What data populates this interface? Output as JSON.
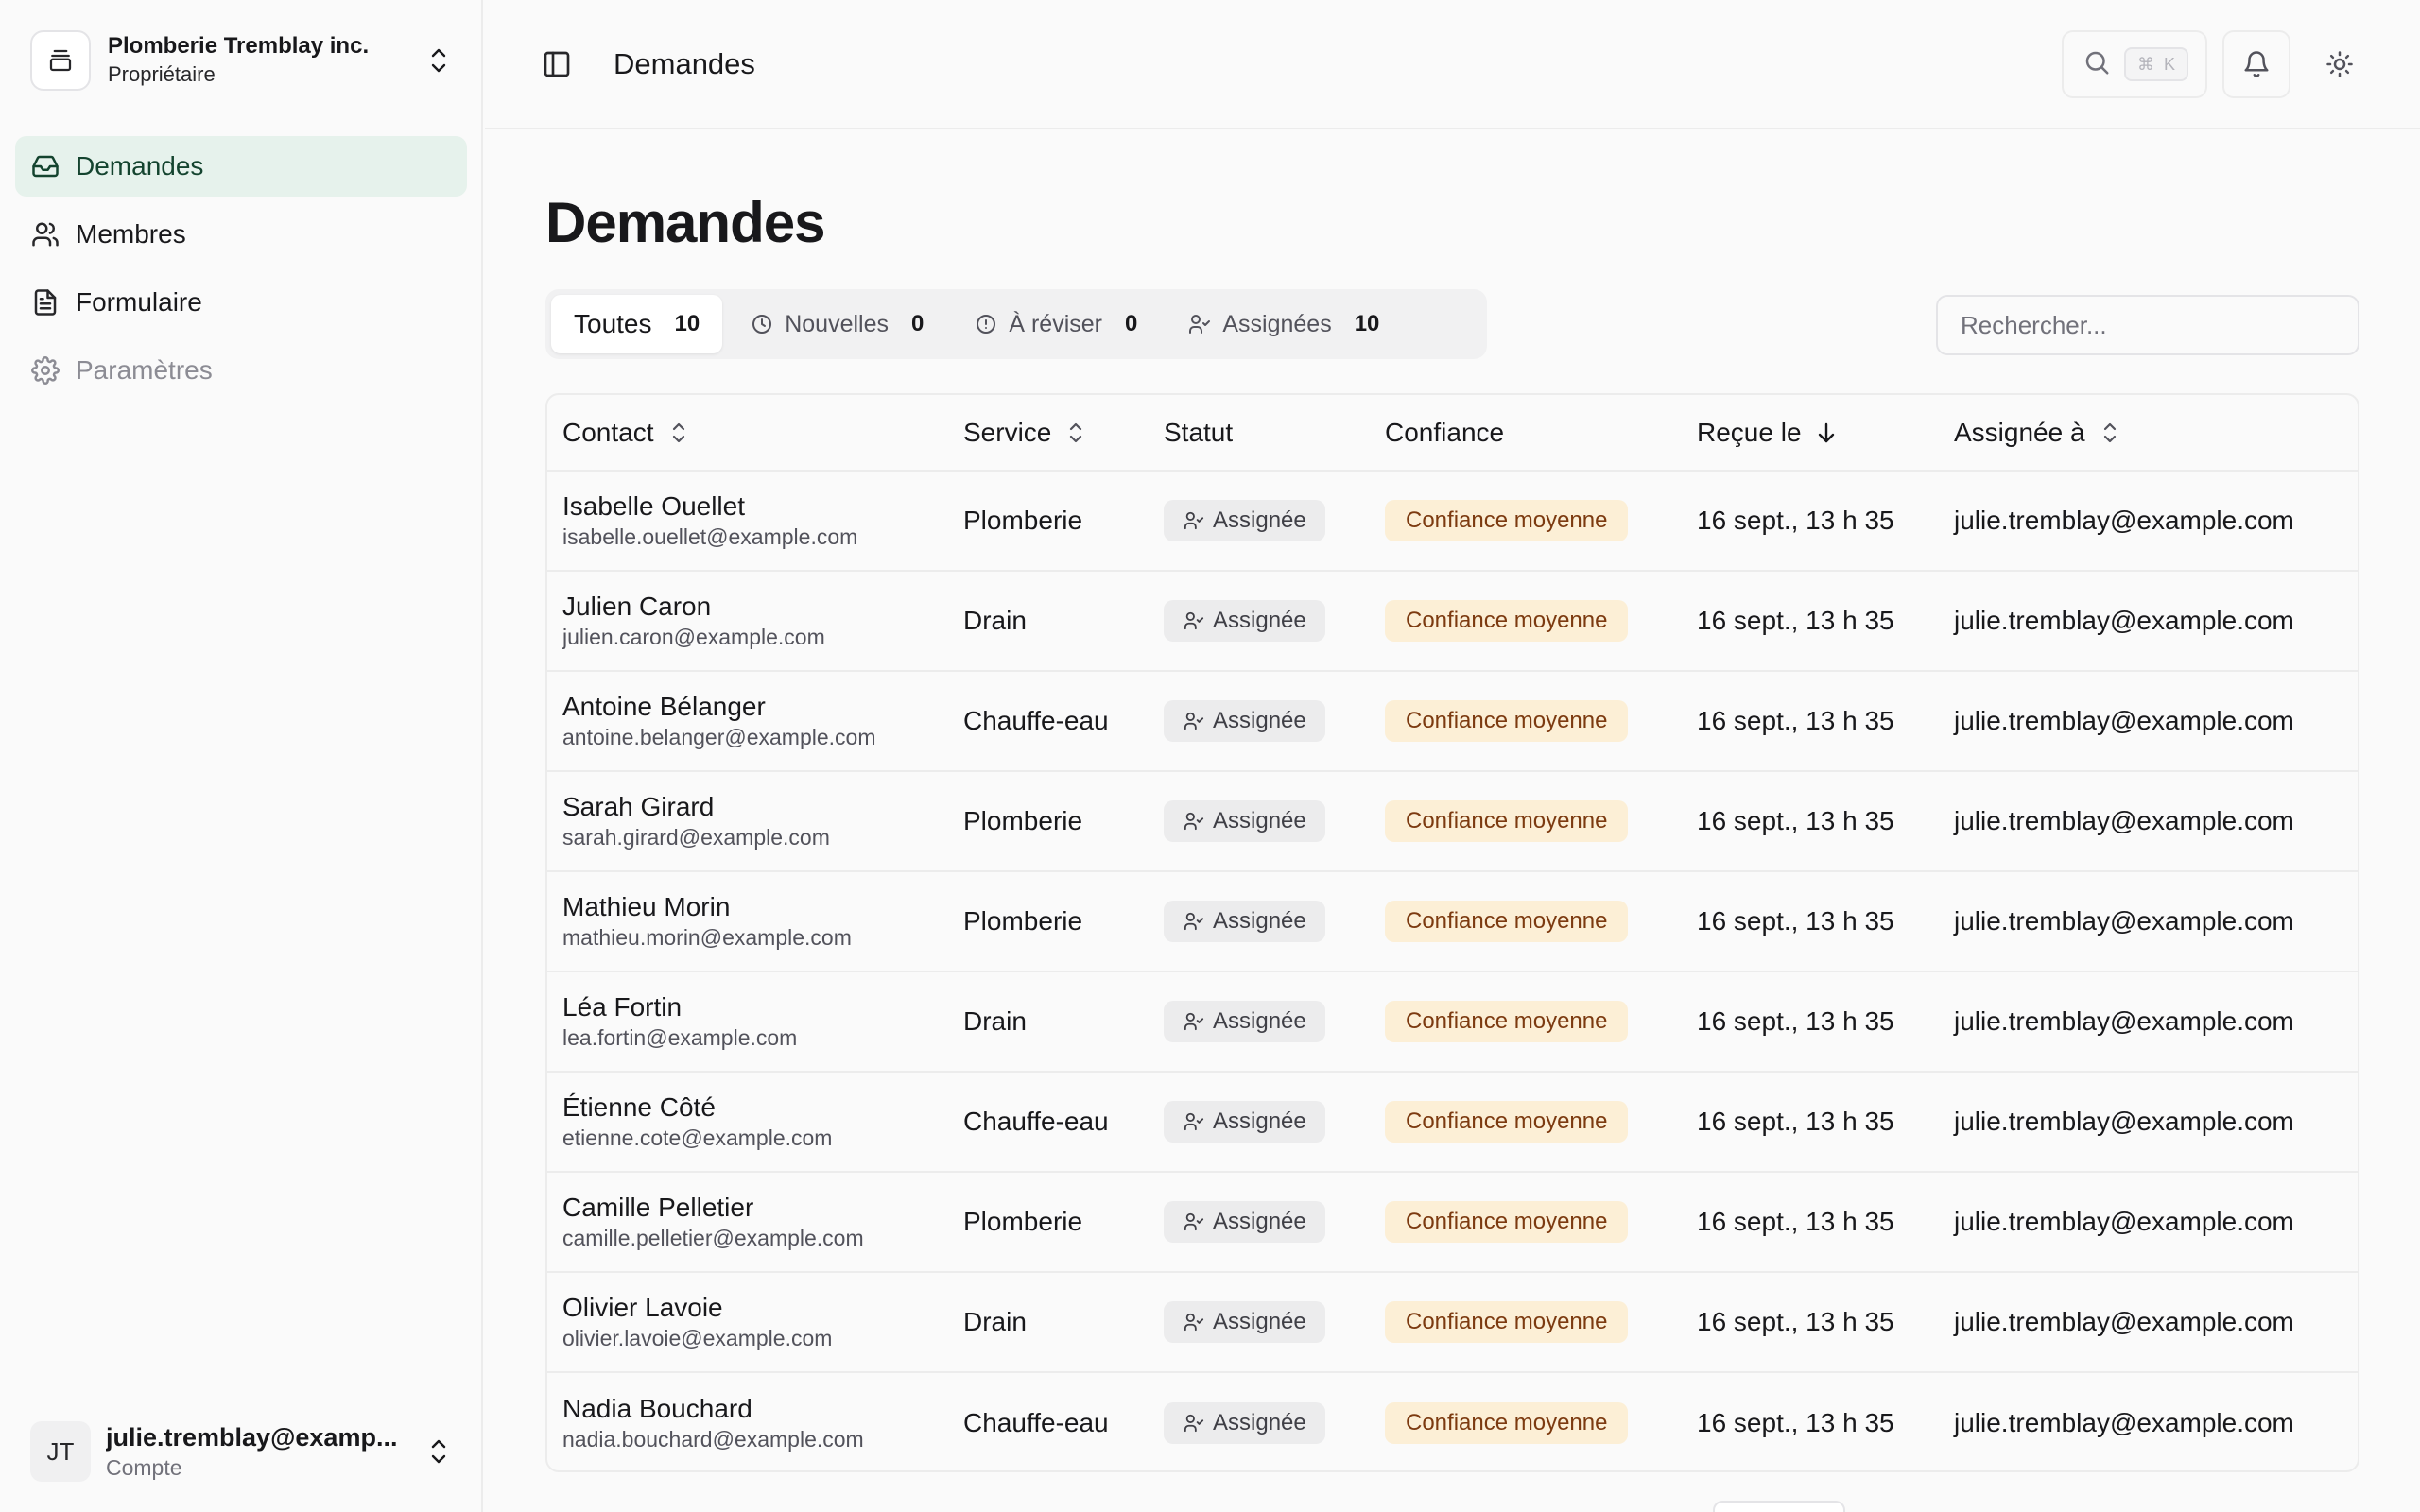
{
  "org": {
    "name": "Plomberie Tremblay inc.",
    "role": "Propriétaire"
  },
  "nav": {
    "items": [
      {
        "label": "Demandes",
        "icon": "inbox-icon",
        "active": true
      },
      {
        "label": "Membres",
        "icon": "users-icon"
      },
      {
        "label": "Formulaire",
        "icon": "file-text-icon"
      },
      {
        "label": "Paramètres",
        "icon": "gear-icon",
        "disabled": true
      }
    ]
  },
  "account": {
    "initials": "JT",
    "email": "julie.tremblay@examp...",
    "label": "Compte"
  },
  "topbar": {
    "breadcrumb": "Demandes",
    "shortcut_symbol": "⌘",
    "shortcut_key": "K"
  },
  "page": {
    "title": "Demandes"
  },
  "tabs": [
    {
      "label": "Toutes",
      "count": "10",
      "active": true
    },
    {
      "label": "Nouvelles",
      "count": "0",
      "icon": "clock-icon"
    },
    {
      "label": "À réviser",
      "count": "0",
      "icon": "alert-circle-icon"
    },
    {
      "label": "Assignées",
      "count": "10",
      "icon": "user-check-icon"
    }
  ],
  "search": {
    "placeholder": "Rechercher..."
  },
  "table": {
    "headers": {
      "contact": "Contact",
      "service": "Service",
      "status": "Statut",
      "confidence": "Confiance",
      "received": "Reçue le",
      "assigned": "Assignée à"
    },
    "rows": [
      {
        "name": "Isabelle Ouellet",
        "email": "isabelle.ouellet@example.com",
        "service": "Plomberie",
        "status": "Assignée",
        "confidence": "Confiance moyenne",
        "received": "16 sept., 13 h 35",
        "assigned": "julie.tremblay@example.com"
      },
      {
        "name": "Julien Caron",
        "email": "julien.caron@example.com",
        "service": "Drain",
        "status": "Assignée",
        "confidence": "Confiance moyenne",
        "received": "16 sept., 13 h 35",
        "assigned": "julie.tremblay@example.com"
      },
      {
        "name": "Antoine Bélanger",
        "email": "antoine.belanger@example.com",
        "service": "Chauffe-eau",
        "status": "Assignée",
        "confidence": "Confiance moyenne",
        "received": "16 sept., 13 h 35",
        "assigned": "julie.tremblay@example.com"
      },
      {
        "name": "Sarah Girard",
        "email": "sarah.girard@example.com",
        "service": "Plomberie",
        "status": "Assignée",
        "confidence": "Confiance moyenne",
        "received": "16 sept., 13 h 35",
        "assigned": "julie.tremblay@example.com"
      },
      {
        "name": "Mathieu Morin",
        "email": "mathieu.morin@example.com",
        "service": "Plomberie",
        "status": "Assignée",
        "confidence": "Confiance moyenne",
        "received": "16 sept., 13 h 35",
        "assigned": "julie.tremblay@example.com"
      },
      {
        "name": "Léa Fortin",
        "email": "lea.fortin@example.com",
        "service": "Drain",
        "status": "Assignée",
        "confidence": "Confiance moyenne",
        "received": "16 sept., 13 h 35",
        "assigned": "julie.tremblay@example.com"
      },
      {
        "name": "Étienne Côté",
        "email": "etienne.cote@example.com",
        "service": "Chauffe-eau",
        "status": "Assignée",
        "confidence": "Confiance moyenne",
        "received": "16 sept., 13 h 35",
        "assigned": "julie.tremblay@example.com"
      },
      {
        "name": "Camille Pelletier",
        "email": "camille.pelletier@example.com",
        "service": "Plomberie",
        "status": "Assignée",
        "confidence": "Confiance moyenne",
        "received": "16 sept., 13 h 35",
        "assigned": "julie.tremblay@example.com"
      },
      {
        "name": "Olivier Lavoie",
        "email": "olivier.lavoie@example.com",
        "service": "Drain",
        "status": "Assignée",
        "confidence": "Confiance moyenne",
        "received": "16 sept., 13 h 35",
        "assigned": "julie.tremblay@example.com"
      },
      {
        "name": "Nadia Bouchard",
        "email": "nadia.bouchard@example.com",
        "service": "Chauffe-eau",
        "status": "Assignée",
        "confidence": "Confiance moyenne",
        "received": "16 sept., 13 h 35",
        "assigned": "julie.tremblay@example.com"
      }
    ]
  },
  "colors": {
    "active_nav_bg": "#e6f2ec",
    "confidence_badge_bg": "#fcefd6",
    "status_badge_bg": "#ececed"
  }
}
